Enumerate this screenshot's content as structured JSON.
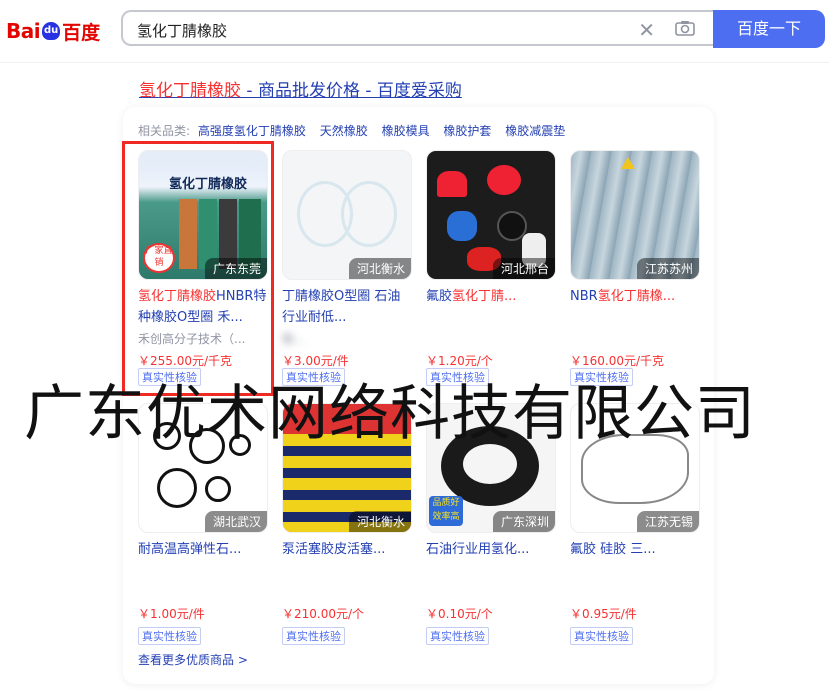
{
  "logo": {
    "text_left": "Bai",
    "paw": "du",
    "text_right": "百度"
  },
  "search": {
    "query": "氢化丁腈橡胶",
    "button": "百度一下"
  },
  "result": {
    "title_hl": "氢化丁腈橡胶",
    "title_rest": " - 商品批发价格 - 百度爱采购"
  },
  "related": {
    "label": "相关品类:",
    "items": [
      "高强度氢化丁腈橡胶",
      "天然橡胶",
      "橡胶模具",
      "橡胶护套",
      "橡胶减震垫"
    ]
  },
  "products": [
    {
      "img_text": "氢化丁腈橡胶",
      "badge": "厂家直销",
      "location": "广东东莞",
      "name_hl": "氢化丁腈橡胶",
      "name_rest": "HNBR特种橡胶O型圈 禾...",
      "shop": "禾创高分子技术（...",
      "price": "￥255.00元/千克",
      "verify": "真实性核验"
    },
    {
      "location": "河北衡水",
      "name_hl": "",
      "name_rest": "丁腈橡胶O型圈 石油行业耐低...",
      "shop": "衡...",
      "price": "￥3.00元/件",
      "verify": "真实性核验"
    },
    {
      "location": "河北邢台",
      "name_hl": "氢化丁腈...",
      "name_rest": "氟胶",
      "shop": "",
      "price": "￥1.20元/个",
      "verify": "真实性核验"
    },
    {
      "location": "江苏苏州",
      "name_hl": "氢化丁腈橡...",
      "name_rest": "NBR",
      "shop": "",
      "price": "￥160.00元/千克",
      "verify": "真实性核验"
    },
    {
      "location": "湖北武汉",
      "name_hl": "",
      "name_rest": "耐高温高弹性石...",
      "shop": "",
      "price": "￥1.00元/件",
      "verify": "真实性核验"
    },
    {
      "location": "河北衡水",
      "name_hl": "",
      "name_rest": "泵活塞胶皮活塞...",
      "shop": "",
      "price": "￥210.00元/个",
      "verify": "真实性核验"
    },
    {
      "location": "广东深圳",
      "badge": "品质好效率高",
      "name_hl": "",
      "name_rest": "石油行业用氢化...",
      "shop": "",
      "price": "￥0.10元/个",
      "verify": "真实性核验"
    },
    {
      "location": "江苏无锡",
      "name_hl": "",
      "name_rest": "氟胶 硅胶 三...",
      "shop": "",
      "price": "￥0.95元/件",
      "verify": "真实性核验"
    }
  ],
  "more": "查看更多优质商品 >",
  "watermark": "广东优术网络科技有限公司",
  "colors": {
    "brand_blue": "#4e6ef2",
    "highlight_red": "#f73131",
    "link_blue": "#2440b3"
  }
}
